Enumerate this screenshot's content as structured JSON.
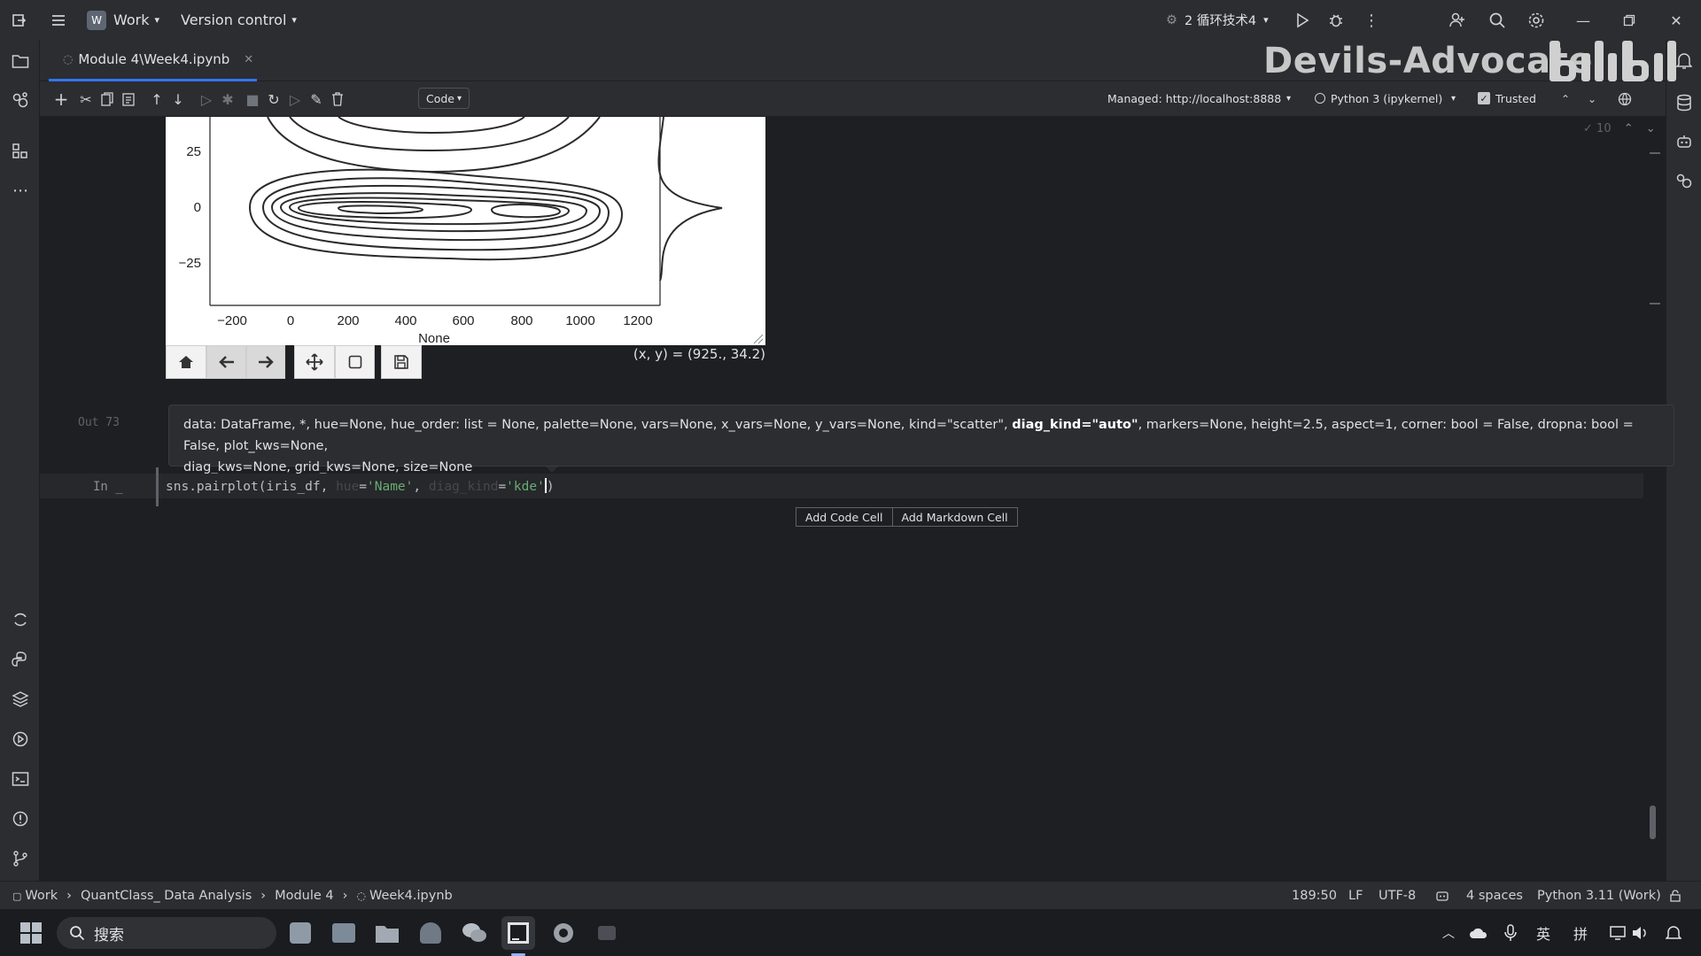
{
  "titlebar": {
    "project": "Work",
    "version_control": "Version control",
    "run_config": "2 循环技术4"
  },
  "tab": {
    "label": "Module 4\\Week4.ipynb"
  },
  "toolbar": {
    "cell_type": "Code",
    "server": "Managed: http://localhost:8888",
    "kernel": "Python 3 (ipykernel)",
    "trusted": "Trusted",
    "inspections": "10"
  },
  "plot": {
    "x_ticks": [
      "−200",
      "0",
      "200",
      "400",
      "600",
      "800",
      "1000",
      "1200"
    ],
    "y_ticks": [
      "25",
      "0",
      "−25"
    ],
    "x_label": "None",
    "coords": "(x, y) = (925., 34.2)"
  },
  "output": {
    "label": "Out 73"
  },
  "tooltip": {
    "part1": "data: DataFrame, *, hue=None, hue_order: list = None, palette=None, vars=None, x_vars=None, y_vars=None, kind=\"scatter\", ",
    "bold": "diag_kind=\"auto\"",
    "part2": ", markers=None, height=2.5, aspect=1, corner: bool = False, dropna: bool = False, plot_kws=None,",
    "line2": "diag_kws=None, grid_kws=None, size=None"
  },
  "cell": {
    "label": "In _",
    "code_fn": "sns.pairplot(iris_df, ",
    "hint1": "hue",
    "code_eq1": "=",
    "str1": "'Name'",
    "code_comma": ", ",
    "hint2": "diag_kind",
    "code_eq2": "=",
    "str2": "'kde'",
    "code_close": ")"
  },
  "add_cells": {
    "code": "Add Code Cell",
    "markdown": "Add Markdown Cell"
  },
  "watermark": "Devils-Advocate",
  "statusbar": {
    "crumbs": [
      "Work",
      "QuantClass_ Data Analysis",
      "Module 4",
      "Week4.ipynb"
    ],
    "position": "189:50",
    "line_sep": "LF",
    "encoding": "UTF-8",
    "indent": "4 spaces",
    "interpreter": "Python 3.11 (Work)"
  },
  "taskbar": {
    "search": "搜索",
    "ime1": "英",
    "ime2": "拼"
  }
}
